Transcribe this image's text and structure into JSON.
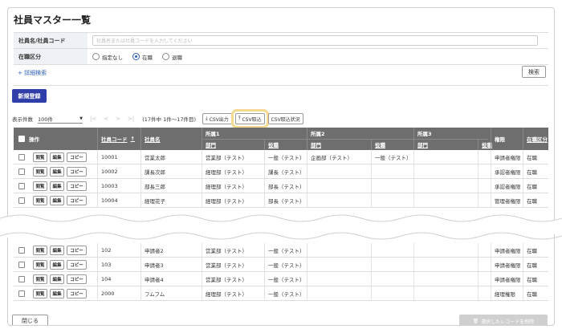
{
  "title": "社員マスター一覧",
  "filters": {
    "name_label": "社員名/社員コード",
    "name_placeholder": "社員名または社員コードを入力してください",
    "status_label": "在職区分",
    "status_options": [
      "指定なし",
      "在職",
      "退職"
    ],
    "status_selected": "在職"
  },
  "detail_search": "+ 詳細検索",
  "search_button": "検索",
  "new_button": "新規登録",
  "pager": {
    "count_label": "表示件数",
    "page_size": "100件",
    "summary": "(17件中 1件～17件目)",
    "first": "|<",
    "prev": "<",
    "next": ">",
    "last": ">|"
  },
  "toolbar": {
    "csv_export": "CSV出力",
    "csv_import": "CSV取込",
    "csv_status": "CSV取込状況"
  },
  "columns": {
    "ops": "操作",
    "code": "社員コード",
    "sort_arrow": "↑",
    "name": "社員名",
    "group1": "所属1",
    "group2": "所属2",
    "group3": "所属3",
    "dept": "部門",
    "post": "役職",
    "auth": "権限",
    "status": "在職区分"
  },
  "row_buttons": {
    "view": "閲覧",
    "edit": "編集",
    "copy": "コピー"
  },
  "rows_top": [
    {
      "code": "10001",
      "name": "営業太郎",
      "dept1": "営業部（テスト）",
      "post1": "一般（テスト）",
      "dept2": "企画部（テスト）",
      "post2": "一般（テスト）",
      "auth": "申請者権限",
      "status": "在職"
    },
    {
      "code": "10002",
      "name": "課長次郎",
      "dept1": "経理部（テスト）",
      "post1": "課長（テスト）",
      "dept2": "",
      "post2": "",
      "auth": "承認者権限",
      "status": "在職"
    },
    {
      "code": "10003",
      "name": "部長三郎",
      "dept1": "経理部（テスト）",
      "post1": "部長（テスト）",
      "dept2": "",
      "post2": "",
      "auth": "承認者権限",
      "status": "在職"
    },
    {
      "code": "10004",
      "name": "経理花子",
      "dept1": "経理部（テスト）",
      "post1": "部長（テスト）",
      "dept2": "",
      "post2": "",
      "auth": "管理者権限",
      "status": "在職"
    }
  ],
  "rows_bottom": [
    {
      "code": "102",
      "name": "申請者2",
      "dept1": "営業部（テスト）",
      "post1": "一般（テスト）",
      "dept2": "",
      "post2": "",
      "auth": "申請者権限",
      "status": "在職"
    },
    {
      "code": "103",
      "name": "申請者3",
      "dept1": "営業部（テスト）",
      "post1": "一般（テスト）",
      "dept2": "",
      "post2": "",
      "auth": "申請者権限",
      "status": "在職"
    },
    {
      "code": "104",
      "name": "申請者4",
      "dept1": "営業部（テスト）",
      "post1": "一般（テスト）",
      "dept2": "",
      "post2": "",
      "auth": "申請者権限",
      "status": "在職"
    },
    {
      "code": "2000",
      "name": "フムフム",
      "dept1": "経理部（テスト）",
      "post1": "一般（テスト）",
      "dept2": "",
      "post2": "",
      "auth": "経理権限",
      "status": "在職"
    }
  ],
  "close_button": "閉じる",
  "delete_button": "選択したレコードを削除",
  "colors": {
    "accent": "#2c5fb8",
    "new_button": "#2f3ea8",
    "header": "#6e6e6e",
    "highlight": "#f5d98f"
  },
  "icons": {
    "download": "download-icon",
    "upload": "upload-icon",
    "trash": "trash-icon",
    "caret": "caret-down-icon"
  }
}
